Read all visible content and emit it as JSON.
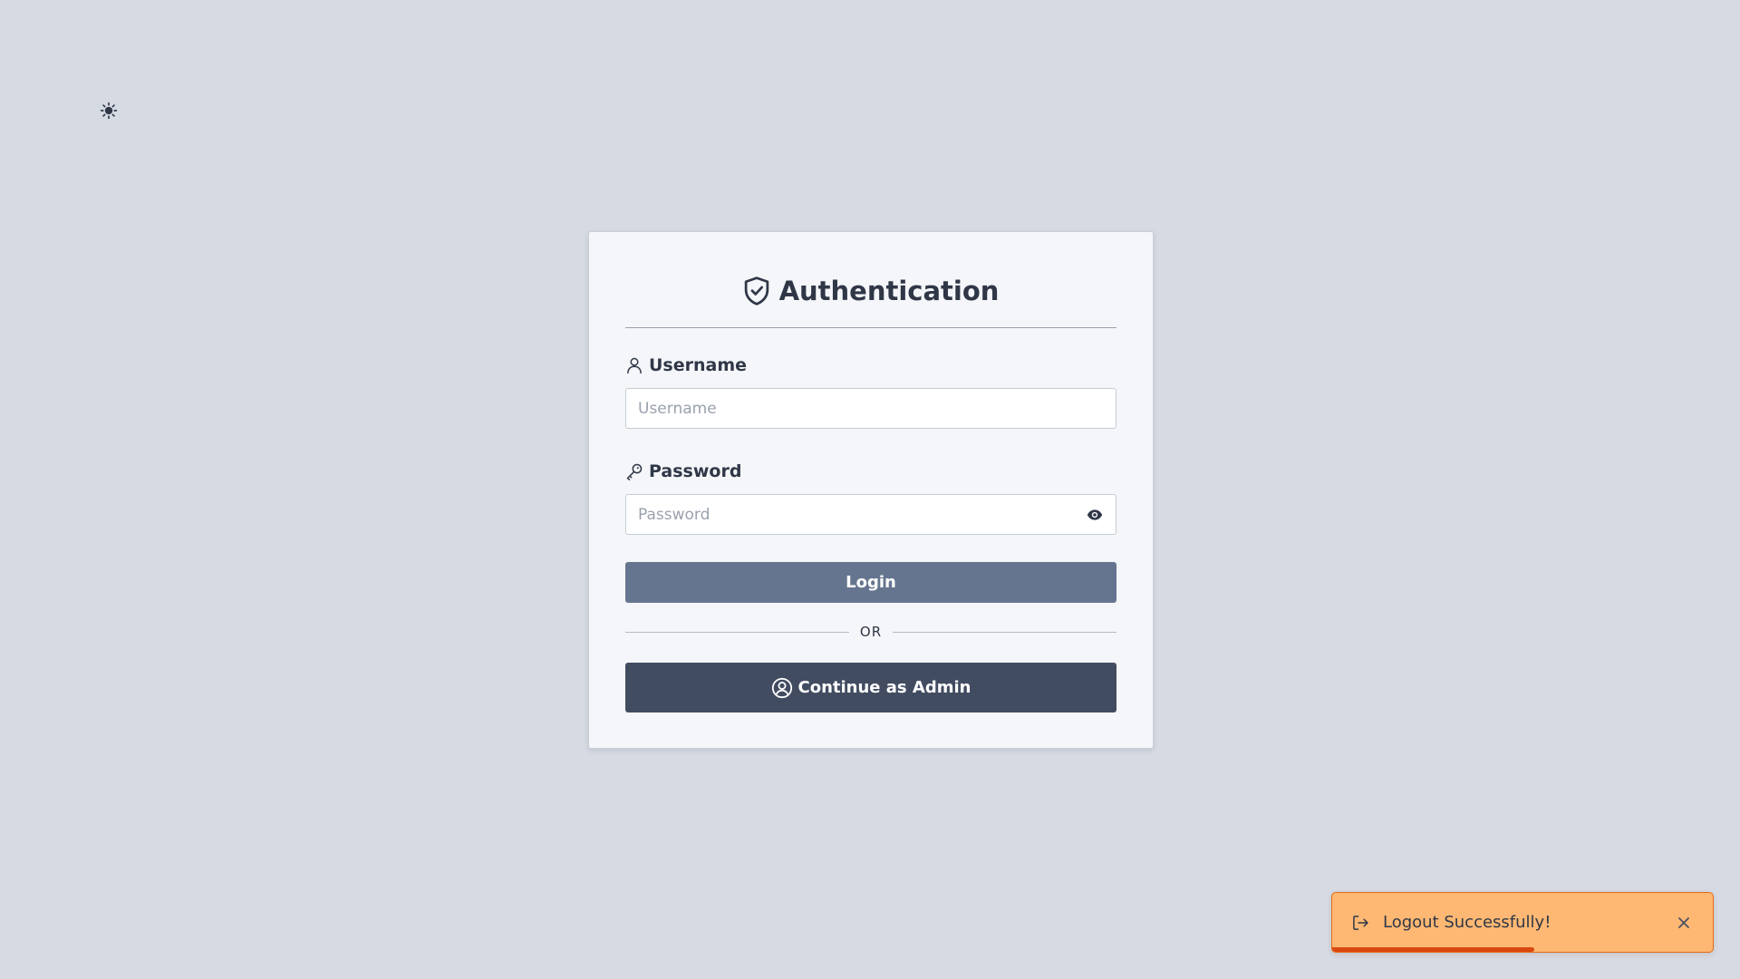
{
  "theme_toggle": {
    "icon": "sun-icon"
  },
  "card": {
    "title": "Authentication",
    "title_icon": "shield-check-icon",
    "username": {
      "label": "Username",
      "icon": "user-icon",
      "value": "",
      "placeholder": "Username"
    },
    "password": {
      "label": "Password",
      "icon": "key-icon",
      "value": "",
      "placeholder": "Password",
      "toggle_icon": "eye-icon"
    },
    "login_label": "Login",
    "or_label": "OR",
    "admin_label": "Continue as Admin",
    "admin_icon": "user-circle-icon"
  },
  "toast": {
    "icon": "logout-icon",
    "message": "Logout Successfully!",
    "close_icon": "close-icon",
    "progress": 0.53
  },
  "colors": {
    "background": "#d6dae3",
    "card": "#f5f6f9",
    "text": "#2f3747",
    "login_button": "#66758f",
    "admin_button": "#424c61",
    "toast_bg": "#ffb873",
    "toast_border": "#e46a1c",
    "toast_progress": "#d9480f"
  }
}
